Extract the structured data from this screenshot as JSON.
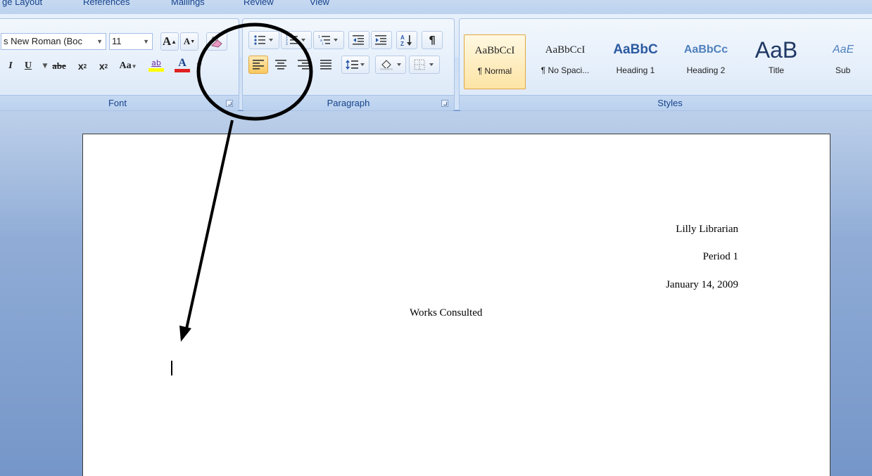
{
  "ribbon": {
    "tabs": [
      "ge Layout",
      "References",
      "Mailings",
      "Review",
      "View"
    ],
    "font_group": {
      "label": "Font",
      "font_name": "s New Roman (Boc",
      "font_size": "11",
      "grow_label": "A",
      "shrink_label": "A",
      "italic_label": "I",
      "underline_label": "U",
      "strike_label": "abe",
      "subscript_label": "x",
      "superscript_label": "x",
      "case_label": "Aa",
      "highlight_label": "ab",
      "font_color_label": "A"
    },
    "paragraph_group": {
      "label": "Paragraph",
      "pilcrow_label": "¶"
    },
    "styles_group": {
      "label": "Styles",
      "items": [
        {
          "sample": "AaBbCcI",
          "name": "¶ Normal"
        },
        {
          "sample": "AaBbCcI",
          "name": "¶ No Spaci..."
        },
        {
          "sample": "AaBbC",
          "name": "Heading 1"
        },
        {
          "sample": "AaBbCc",
          "name": "Heading 2"
        },
        {
          "sample": "AaB",
          "name": "Title"
        },
        {
          "sample": "AaE",
          "name": "Sub"
        }
      ]
    }
  },
  "document": {
    "header_lines": [
      "Lilly Librarian",
      "Period 1",
      "January 14, 2009"
    ],
    "title": "Works Consulted"
  },
  "colors": {
    "annotation": "#000000",
    "active_button": "#f9c85e",
    "font_color_bar": "#e02020",
    "highlight_bar": "#ffff00"
  },
  "icons": {
    "clear_formatting": "eraser-icon",
    "bullets": "bullets-icon",
    "numbering": "numbering-icon",
    "multilevel": "multilevel-list-icon",
    "decrease_indent": "decrease-indent-icon",
    "increase_indent": "increase-indent-icon",
    "sort": "sort-icon",
    "align_left": "align-left-icon",
    "center": "align-center-icon",
    "align_right": "align-right-icon",
    "justify": "justify-icon",
    "line_spacing": "line-spacing-icon",
    "shading": "shading-bucket-icon",
    "borders": "borders-icon"
  }
}
